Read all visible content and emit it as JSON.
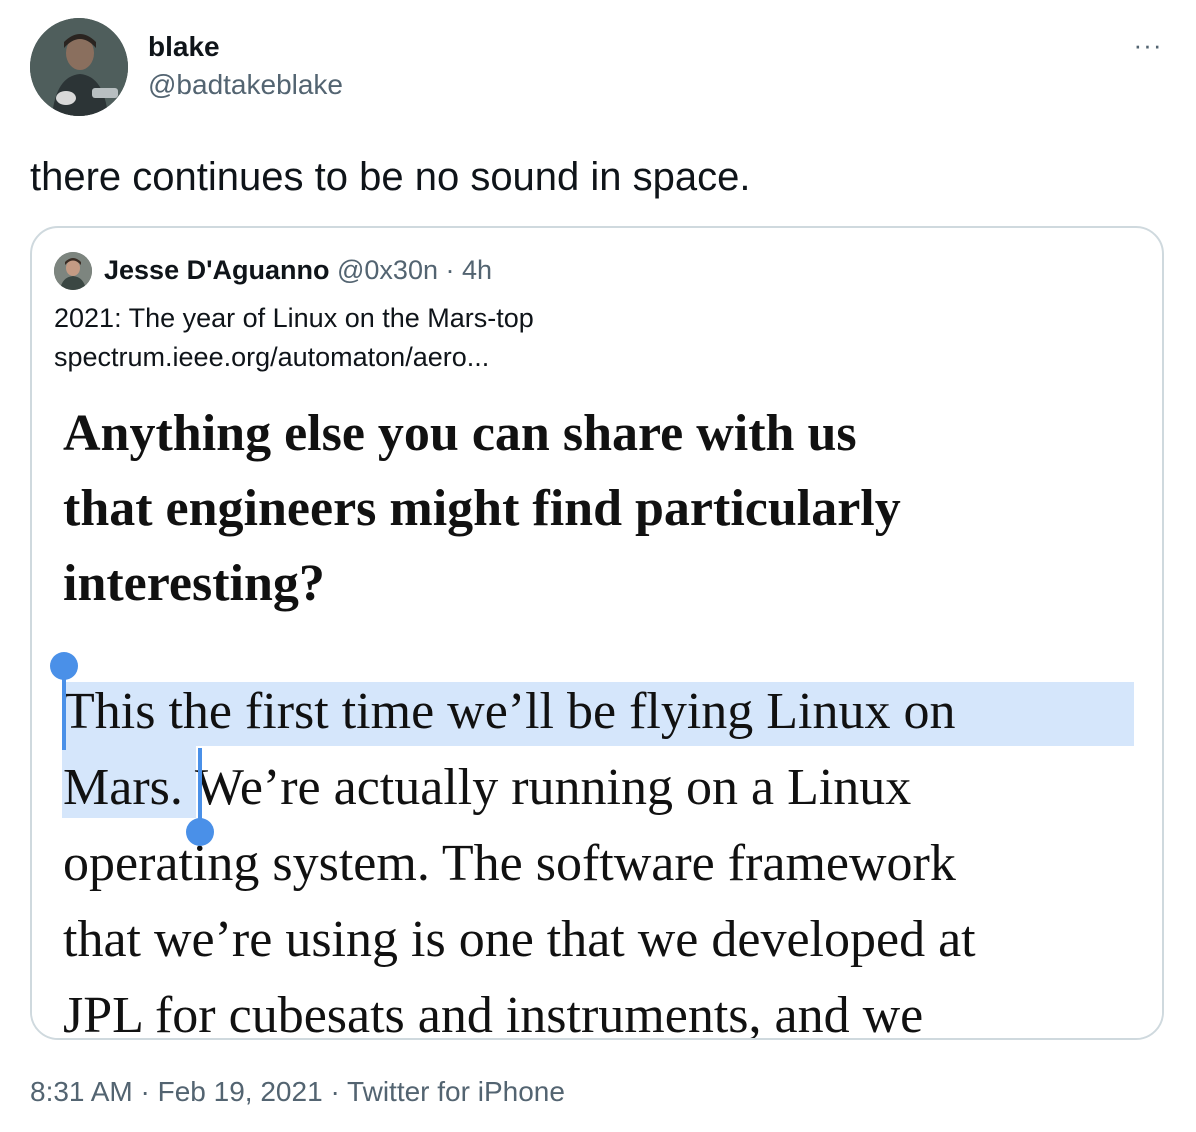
{
  "tweet": {
    "author": {
      "name": "blake",
      "handle": "@badtakeblake"
    },
    "more_icon": "more-horizontal-icon",
    "more_label": "···",
    "text": "there continues to be no sound in space.",
    "meta": {
      "time": "8:31 AM",
      "separator": "·",
      "date": "Feb 19, 2021",
      "source": "Twitter for iPhone"
    }
  },
  "quoted": {
    "author": {
      "name": "Jesse D'Aguanno",
      "handle": "@0x30n",
      "separator": "·",
      "time": "4h"
    },
    "text_line1": "2021: The year of Linux on the Mars-top",
    "text_line2": "spectrum.ieee.org/automaton/aero...",
    "image": {
      "heading_lines": [
        "Anything else you can share with us",
        "that engineers might find particularly",
        "interesting?"
      ],
      "body_lines": [
        "This the first time we’ll be flying Linux on",
        "Mars. We’re actually running on a Linux",
        "operating system. The software framework",
        "that we’re using is one that we developed at",
        "JPL for cubesats and instruments, and we"
      ],
      "highlight_color": "#d5e6fb",
      "selection_handle_color": "#4a90e8"
    }
  },
  "colors": {
    "text_primary": "#0f1419",
    "text_secondary": "#536471",
    "card_border": "#cfd9de"
  }
}
